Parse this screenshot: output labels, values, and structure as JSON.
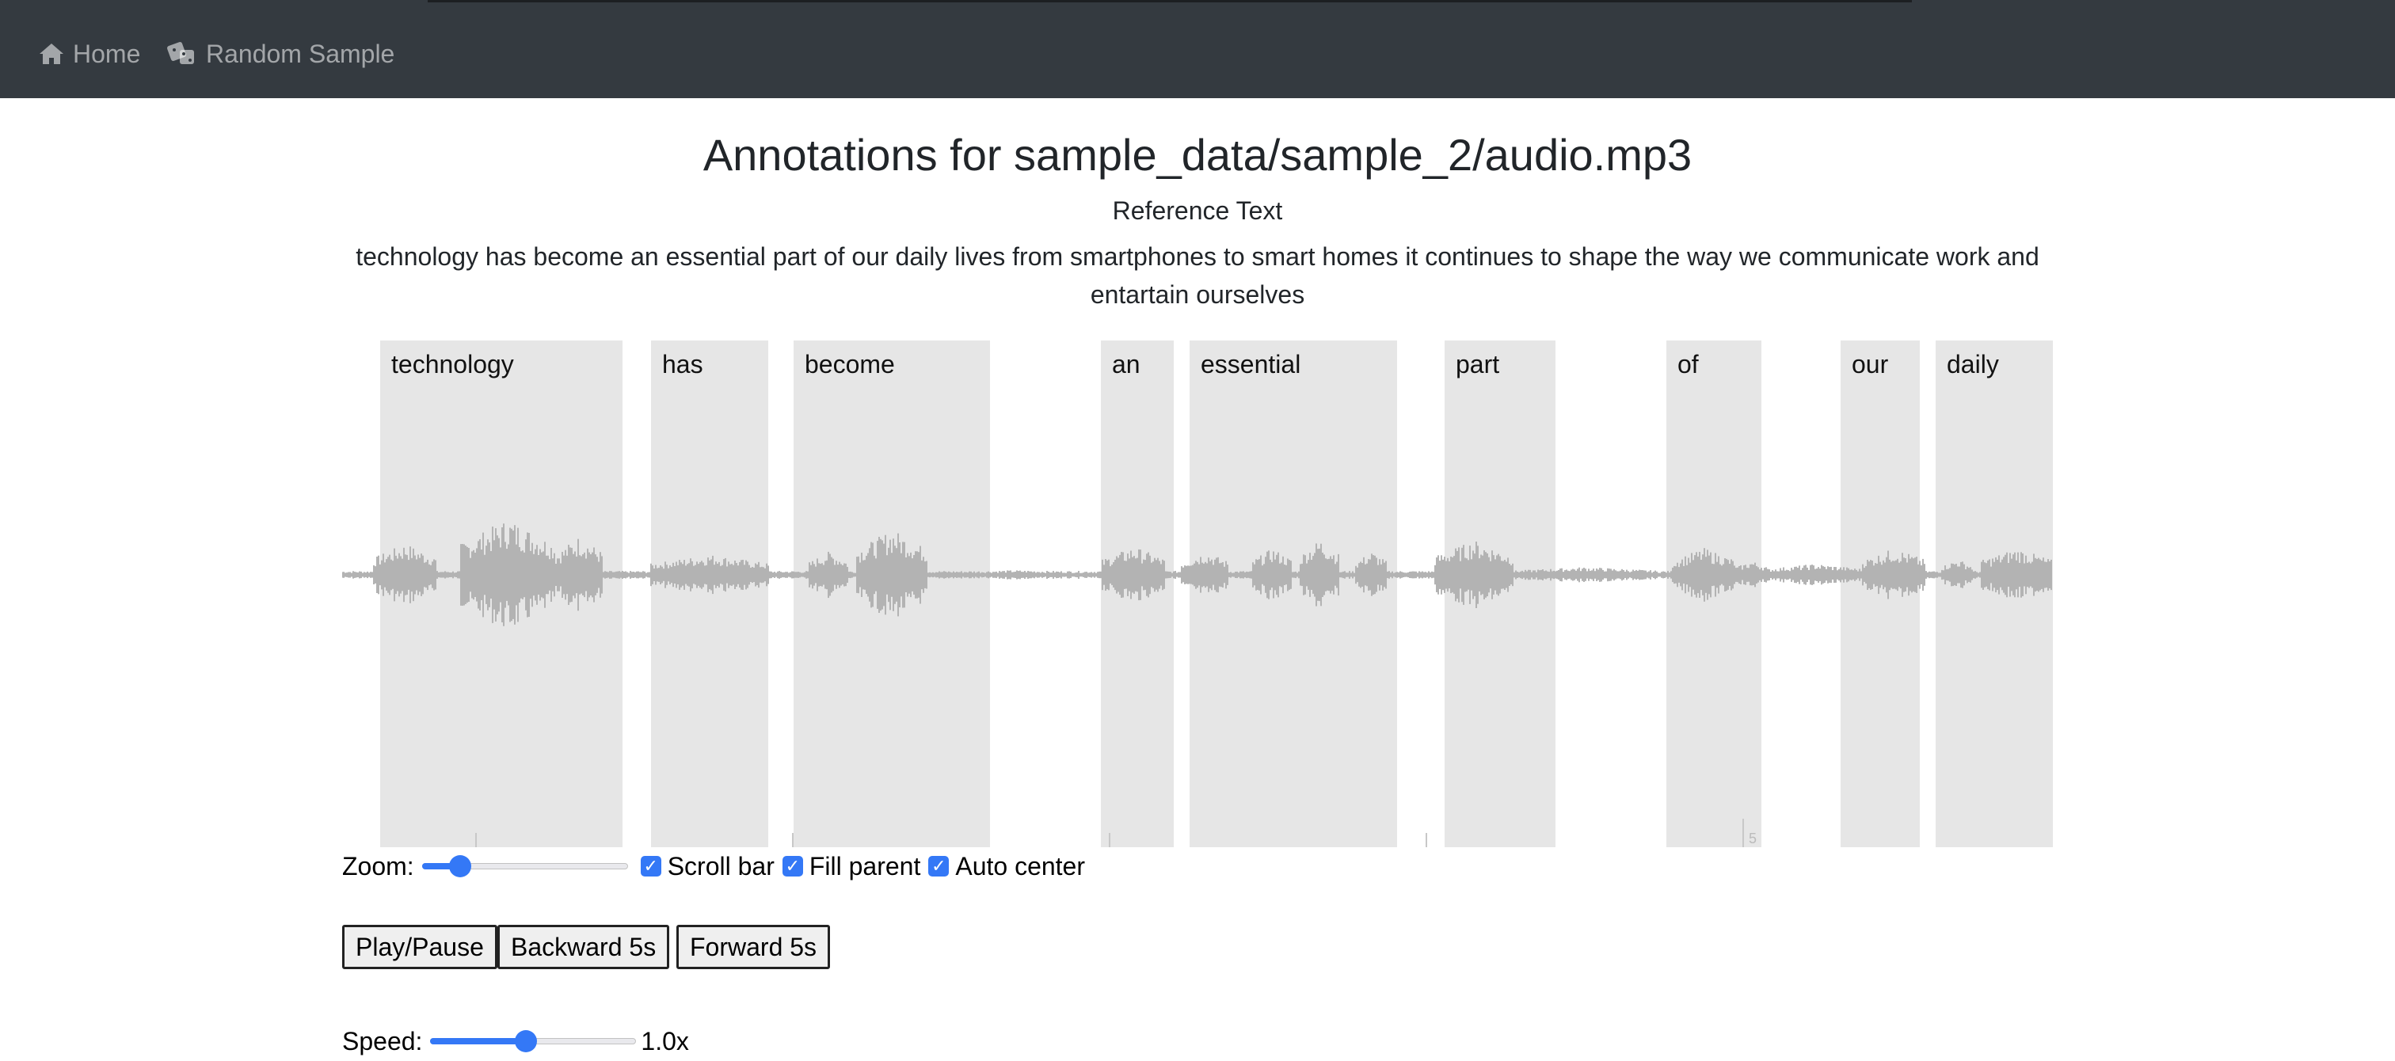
{
  "nav": {
    "home_label": "Home",
    "random_label": "Random Sample"
  },
  "page": {
    "title": "Annotations for sample_data/sample_2/audio.mp3",
    "reference_heading": "Reference Text",
    "reference_text": "technology has become an essential part of our daily lives from smartphones to smart homes it continues to shape the way we communicate work and entartain ourselves"
  },
  "regions": [
    {
      "word": "technology"
    },
    {
      "word": "has"
    },
    {
      "word": "become"
    },
    {
      "word": "an"
    },
    {
      "word": "essential"
    },
    {
      "word": "part"
    },
    {
      "word": "of"
    },
    {
      "word": "our"
    },
    {
      "word": "daily"
    }
  ],
  "timeline": {
    "visible_label": "5"
  },
  "controls": {
    "zoom_label": "Zoom:",
    "zoom_value": 0.15,
    "scroll_bar_label": "Scroll bar",
    "scroll_bar_checked": true,
    "fill_parent_label": "Fill parent",
    "fill_parent_checked": true,
    "auto_center_label": "Auto center",
    "auto_center_checked": true,
    "play_pause_label": "Play/Pause",
    "backward_label": "Backward 5s",
    "forward_label": "Forward 5s",
    "speed_label": "Speed:",
    "speed_value_text": "1.0x",
    "speed_fraction": 0.46
  },
  "colors": {
    "navbar": "#343a40",
    "accent": "#3478f6",
    "region": "#e4e4e4",
    "wave": "#b3b3b3"
  }
}
